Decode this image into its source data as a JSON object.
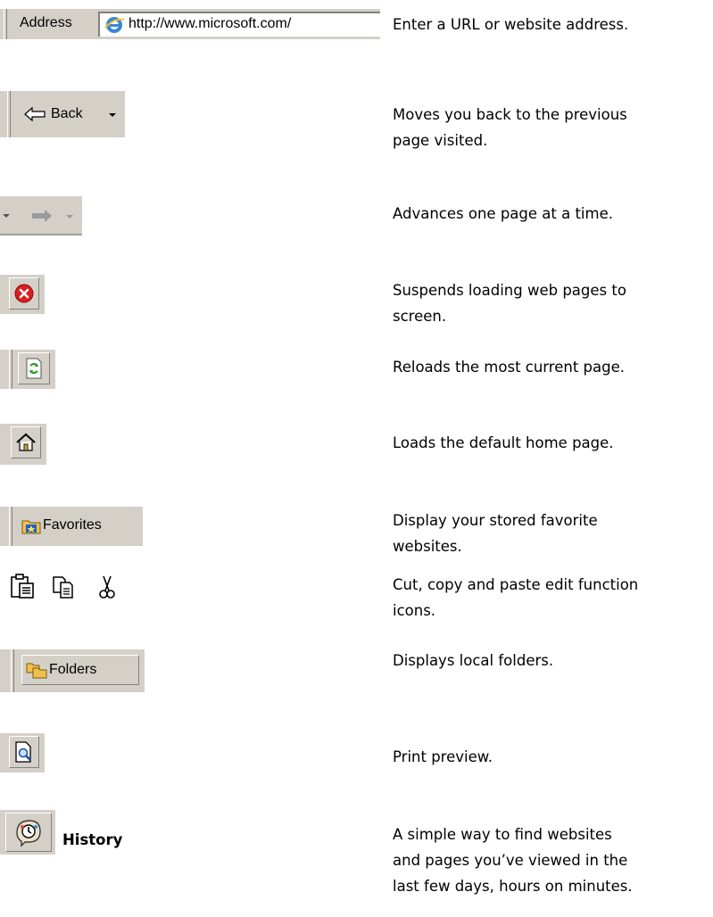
{
  "rows": [
    {
      "label": "Address",
      "url": "http://www.microsoft.com/",
      "desc": [
        "Enter a URL or website address."
      ]
    },
    {
      "label": "Back",
      "desc": [
        "Moves you back to the previous",
        "page visited."
      ]
    },
    {
      "desc": [
        "Advances one page at a time."
      ]
    },
    {
      "desc": [
        "Suspends loading web pages to",
        "screen."
      ]
    },
    {
      "desc": [
        "Reloads the most current page."
      ]
    },
    {
      "desc": [
        "Loads the default home page."
      ]
    },
    {
      "label": "Favorites",
      "desc": [
        "Display your stored favorite",
        "websites."
      ]
    },
    {
      "desc": [
        "Cut, copy and paste edit function",
        "icons."
      ]
    },
    {
      "label": "Folders",
      "desc": [
        "Displays local folders."
      ]
    },
    {
      "desc": [
        "Print preview."
      ]
    },
    {
      "label": "History",
      "desc": [
        "A simple way to find websites",
        "and pages you’ve viewed in the",
        "last few days, hours on minutes."
      ]
    }
  ],
  "icons": {
    "address": "ie-logo-icon",
    "back": "back-arrow-icon",
    "forward": "forward-arrow-icon",
    "stop": "stop-icon",
    "refresh": "refresh-icon",
    "home": "home-icon",
    "favorites": "favorites-folder-icon",
    "paste": "paste-icon",
    "copy": "copy-icon",
    "cut": "cut-icon",
    "folders": "folders-icon",
    "print_preview": "print-preview-icon",
    "history": "history-icon"
  },
  "colors": {
    "toolbar_bg": "#d4d0c8",
    "stop_red": "#d81e1e",
    "refresh_green": "#2e9b2e",
    "folder_yellow": "#f1c04c"
  }
}
